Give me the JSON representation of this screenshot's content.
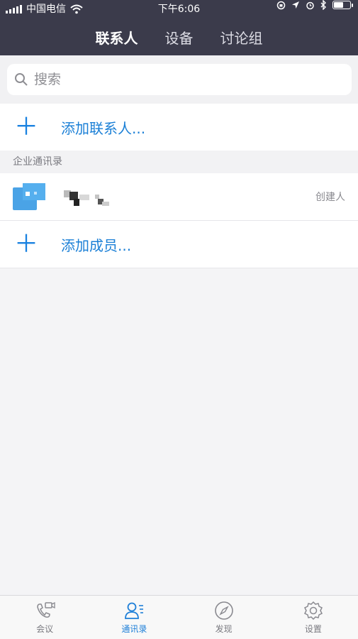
{
  "status_bar": {
    "carrier": "中国电信",
    "time": "下午6:06",
    "battery_level": 0.55
  },
  "nav": {
    "tabs": [
      "联系人",
      "设备",
      "讨论组"
    ],
    "active": 0
  },
  "search": {
    "placeholder": "搜索"
  },
  "add_contact": {
    "label": "添加联系人..."
  },
  "directory": {
    "section_title": "企业通讯录",
    "member": {
      "name": "",
      "role": "创建人"
    },
    "add_member_label": "添加成员..."
  },
  "tabbar": {
    "items": [
      {
        "label": "会议",
        "icon": "meeting-camera-icon"
      },
      {
        "label": "通讯录",
        "icon": "contacts-icon"
      },
      {
        "label": "发现",
        "icon": "compass-icon"
      },
      {
        "label": "设置",
        "icon": "gear-icon"
      }
    ],
    "active": 1
  },
  "colors": {
    "header_bg": "#3b3b4b",
    "accent": "#1a7fd6"
  }
}
